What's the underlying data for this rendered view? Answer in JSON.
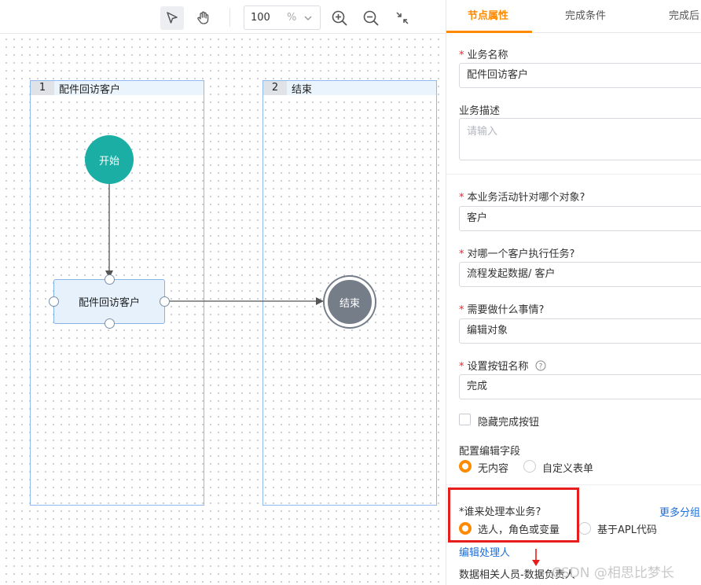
{
  "toolbar": {
    "zoom_value": "100",
    "zoom_unit": "%",
    "tools": [
      "select-tool",
      "hand-tool",
      "zoom-in",
      "zoom-out",
      "fit-screen"
    ]
  },
  "lanes": [
    {
      "num": "1",
      "title": "配件回访客户"
    },
    {
      "num": "2",
      "title": "结束"
    }
  ],
  "nodes": {
    "start": "开始",
    "task": "配件回访客户",
    "end": "结束"
  },
  "panel": {
    "tabs": [
      "节点属性",
      "完成条件",
      "完成后"
    ],
    "business_name_label": "业务名称",
    "business_name_value": "配件回访客户",
    "business_desc_label": "业务描述",
    "business_desc_placeholder": "请输入",
    "target_object_label": "本业务活动针对哪个对象?",
    "target_object_value": "客户",
    "which_customer_label": "对哪一个客户执行任务?",
    "which_customer_value": "流程发起数据/ 客户",
    "what_to_do_label": "需要做什么事情?",
    "what_to_do_value": "编辑对象",
    "button_name_label": "设置按钮名称",
    "button_name_value": "完成",
    "hide_button_label": "隐藏完成按钮",
    "edit_fields_label": "配置编辑字段",
    "edit_fields_options": [
      "无内容",
      "自定义表单"
    ],
    "handler_label": "*谁来处理本业务?",
    "more_groups_link": "更多分组",
    "handler_options": [
      "选人，角色或变量",
      "基于APL代码"
    ],
    "edit_handler_link": "编辑处理人",
    "handler_value": "数据相关人员-数据负责人"
  },
  "watermark": "CSDN @相思比梦长",
  "colors": {
    "accent": "#ff8a00",
    "start_node": "#1aaea4",
    "end_node": "#757d88",
    "lane_border": "#8fb9ef",
    "link": "#1e6fd9",
    "highlight": "#e61e1e"
  }
}
